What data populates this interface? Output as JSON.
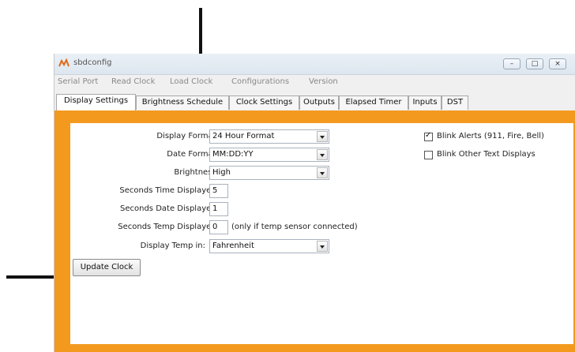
{
  "window": {
    "title": "sbdconfig",
    "controls": {
      "minimize": "–",
      "maximize": "□",
      "close": "×"
    }
  },
  "menu": [
    "Serial Port",
    "Read Clock",
    "Load Clock",
    "Configurations",
    "Version"
  ],
  "tabs": [
    "Display Settings",
    "Brightness Schedule",
    "Clock Settings",
    "Outputs",
    "Elapsed Timer",
    "Inputs",
    "DST"
  ],
  "active_tab": "Display Settings",
  "form": {
    "display_format": {
      "label": "Display Format:",
      "value": "24 Hour Format"
    },
    "date_format": {
      "label": "Date Format:",
      "value": "MM:DD:YY"
    },
    "brightness": {
      "label": "Brightness:",
      "value": "High"
    },
    "seconds_time": {
      "label": "Seconds Time Displayed:",
      "value": "5"
    },
    "seconds_date": {
      "label": "Seconds Date Displayed:",
      "value": "1"
    },
    "seconds_temp": {
      "label": "Seconds Temp Displayed:",
      "value": "0",
      "note": "(only if temp sensor connected)"
    },
    "display_temp": {
      "label": "Display Temp in:",
      "value": "Fahrenheit"
    }
  },
  "checkboxes": {
    "blink_alerts": {
      "label": "Blink Alerts (911, Fire, Bell)",
      "checked": true,
      "mark": "✓"
    },
    "blink_other": {
      "label": "Blink Other Text Displays",
      "checked": false
    }
  },
  "update_button": "Update Clock",
  "colors": {
    "panel_border": "#f39a1e",
    "arrow": "#111111"
  },
  "icons": {
    "app": "app-icon",
    "arrow_down": "down-arrow-icon",
    "arrow_right": "right-arrow-icon"
  }
}
